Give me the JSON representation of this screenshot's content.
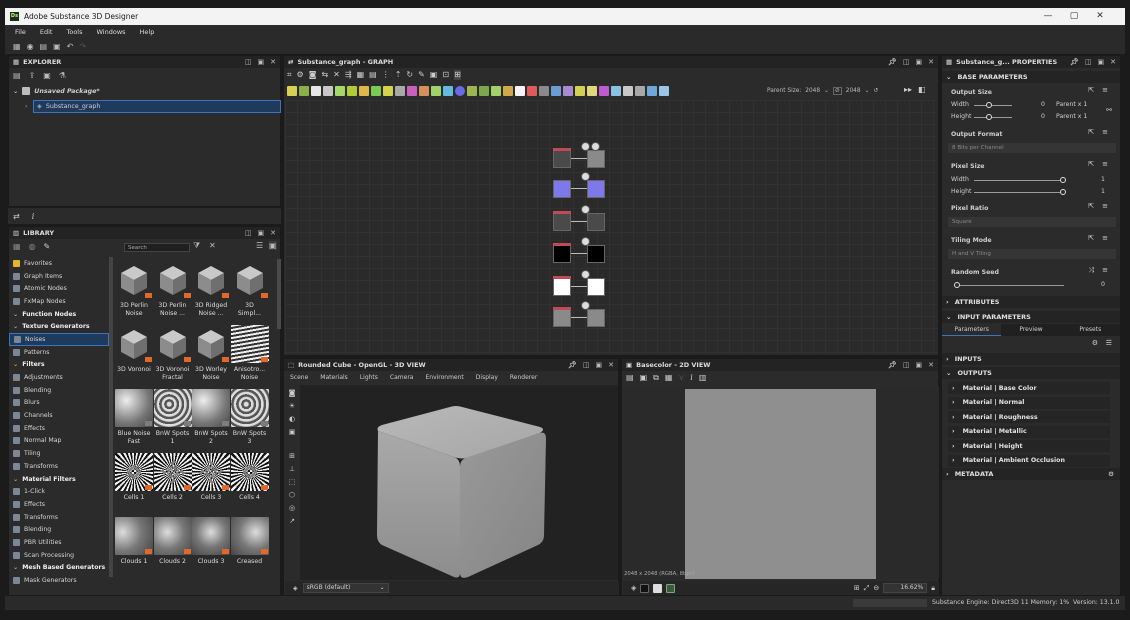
{
  "app": {
    "title": "Adobe Substance 3D Designer",
    "logo_text": "Ds"
  },
  "window_controls": {
    "minimize": "—",
    "maximize": "▢",
    "close": "✕"
  },
  "menu": [
    "File",
    "Edit",
    "Tools",
    "Windows",
    "Help"
  ],
  "explorer": {
    "title": "EXPLORER",
    "package": "Unsaved Package*",
    "graph": "Substance_graph"
  },
  "library": {
    "title": "LIBRARY",
    "search_placeholder": "Search",
    "categories": [
      {
        "label": "Favorites",
        "header": false
      },
      {
        "label": "Graph Items",
        "header": false
      },
      {
        "label": "Atomic Nodes",
        "header": false
      },
      {
        "label": "FxMap Nodes",
        "header": false
      },
      {
        "label": "Function Nodes",
        "header": true
      },
      {
        "label": "Texture Generators",
        "header": true
      },
      {
        "label": "Noises",
        "header": false,
        "selected": true
      },
      {
        "label": "Patterns",
        "header": false
      },
      {
        "label": "Filters",
        "header": true
      },
      {
        "label": "Adjustments",
        "header": false
      },
      {
        "label": "Blending",
        "header": false
      },
      {
        "label": "Blurs",
        "header": false
      },
      {
        "label": "Channels",
        "header": false
      },
      {
        "label": "Effects",
        "header": false
      },
      {
        "label": "Normal Map",
        "header": false
      },
      {
        "label": "Tiling",
        "header": false
      },
      {
        "label": "Transforms",
        "header": false
      },
      {
        "label": "Material Filters",
        "header": true
      },
      {
        "label": "1-Click",
        "header": false
      },
      {
        "label": "Effects",
        "header": false
      },
      {
        "label": "Transforms",
        "header": false
      },
      {
        "label": "Blending",
        "header": false
      },
      {
        "label": "PBR Utilities",
        "header": false
      },
      {
        "label": "Scan Processing",
        "header": false
      },
      {
        "label": "Mesh Based Generators",
        "header": true
      },
      {
        "label": "Mask Generators",
        "header": false
      }
    ],
    "thumbs": [
      [
        "3D Perlin",
        "Noise"
      ],
      [
        "3D Perlin",
        "Noise ..."
      ],
      [
        "3D Ridged",
        "Noise ..."
      ],
      [
        "3D",
        "Simpl..."
      ],
      [
        "3D Voronoi",
        ""
      ],
      [
        "3D Voronoi",
        "Fractal"
      ],
      [
        "3D Worley",
        "Noise"
      ],
      [
        "Anisotro...",
        "Noise"
      ],
      [
        "Blue Noise",
        "Fast"
      ],
      [
        "BnW Spots",
        "1"
      ],
      [
        "BnW Spots",
        "2"
      ],
      [
        "BnW Spots",
        "3"
      ],
      [
        "Cells 1",
        ""
      ],
      [
        "Cells 2",
        ""
      ],
      [
        "Cells 3",
        ""
      ],
      [
        "Cells 4",
        ""
      ],
      [
        "Clouds 1",
        ""
      ],
      [
        "Clouds 2",
        ""
      ],
      [
        "Clouds 3",
        ""
      ],
      [
        "Creased",
        ""
      ]
    ]
  },
  "graph": {
    "title": "Substance_graph - GRAPH",
    "parent_size_label": "Parent Size:",
    "parent_size": "2048",
    "size": "2048"
  },
  "view3d": {
    "title": "Rounded Cube - OpenGL - 3D VIEW",
    "menu": [
      "Scene",
      "Materials",
      "Lights",
      "Camera",
      "Environment",
      "Display",
      "Renderer"
    ],
    "colorspace": "sRGB (default)"
  },
  "view2d": {
    "title": "Basecolor - 2D VIEW",
    "info": "2048 x 2048 (RGBA, 8bpc)",
    "zoom": "16.62%"
  },
  "properties": {
    "title": "Substance_g... PROPERTIES",
    "base_parameters": "BASE PARAMETERS",
    "output_size": "Output Size",
    "width_label": "Width",
    "height_label": "Height",
    "width_value": "0",
    "height_value": "0",
    "parent_x_width": "Parent x 1",
    "parent_x_height": "Parent x 1",
    "output_format": "Output Format",
    "output_format_value": "8 Bits per Channel",
    "pixel_size": "Pixel Size",
    "pixel_width_label": "Width",
    "pixel_height_label": "Height",
    "pixel_width": "1",
    "pixel_height": "1",
    "pixel_ratio": "Pixel Ratio",
    "pixel_ratio_value": "Square",
    "tiling_mode": "Tiling Mode",
    "tiling_mode_value": "H and V Tiling",
    "random_seed": "Random Seed",
    "random_seed_value": "0",
    "attributes": "ATTRIBUTES",
    "input_parameters": "INPUT PARAMETERS",
    "tabs": [
      "Parameters",
      "Preview",
      "Presets"
    ],
    "inputs": "INPUTS",
    "outputs": "OUTPUTS",
    "output_items": [
      "Material | Base Color",
      "Material | Normal",
      "Material | Roughness",
      "Material | Metallic",
      "Material | Height",
      "Material | Ambient Occlusion"
    ],
    "metadata": "METADATA"
  },
  "status": {
    "engine": "Substance Engine: Direct3D 11  Memory: 1%",
    "version": "Version: 13.1.0"
  },
  "colors": {
    "accent": "#3d74c0",
    "node_header": "#c14a5a",
    "node_blue": "#7d79ea"
  }
}
